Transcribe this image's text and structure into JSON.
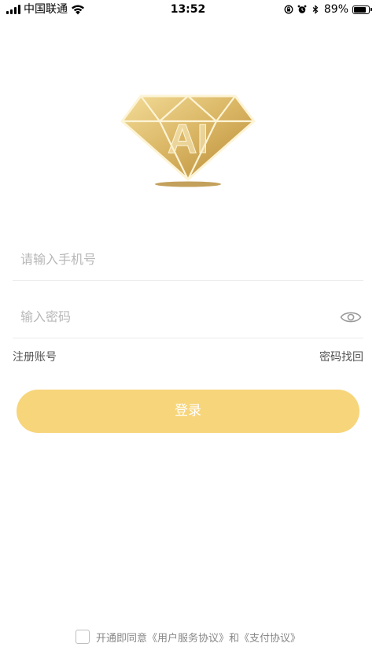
{
  "status_bar": {
    "carrier": "中国联通",
    "time": "13:52",
    "battery_percent_label": "89%",
    "battery_level": 0.89,
    "icons": [
      "signal-icon",
      "wifi-icon",
      "orientation-lock-icon",
      "alarm-icon",
      "bluetooth-icon",
      "battery-icon"
    ]
  },
  "logo": {
    "text": "AI",
    "icon": "diamond-logo",
    "colors": {
      "gold_light": "#f3dc98",
      "gold_dark": "#c49a45",
      "shadow": "#b98f3e"
    }
  },
  "form": {
    "phone": {
      "value": "",
      "placeholder": "请输入手机号"
    },
    "password": {
      "value": "",
      "placeholder": "输入密码",
      "toggle_icon": "eye-icon"
    },
    "register_label": "注册账号",
    "forgot_label": "密码找回",
    "login_label": "登录"
  },
  "agreement": {
    "prefix": "开通即同意",
    "user_agreement": "《用户服务协议》",
    "conjunction": "和",
    "payment_agreement": "《支付协议》",
    "checked": false
  },
  "colors": {
    "button_bg": "#f7d57b",
    "button_text": "#ffffff",
    "placeholder": "#b8b8b8",
    "divider": "#ececec",
    "link_text": "#555555"
  }
}
